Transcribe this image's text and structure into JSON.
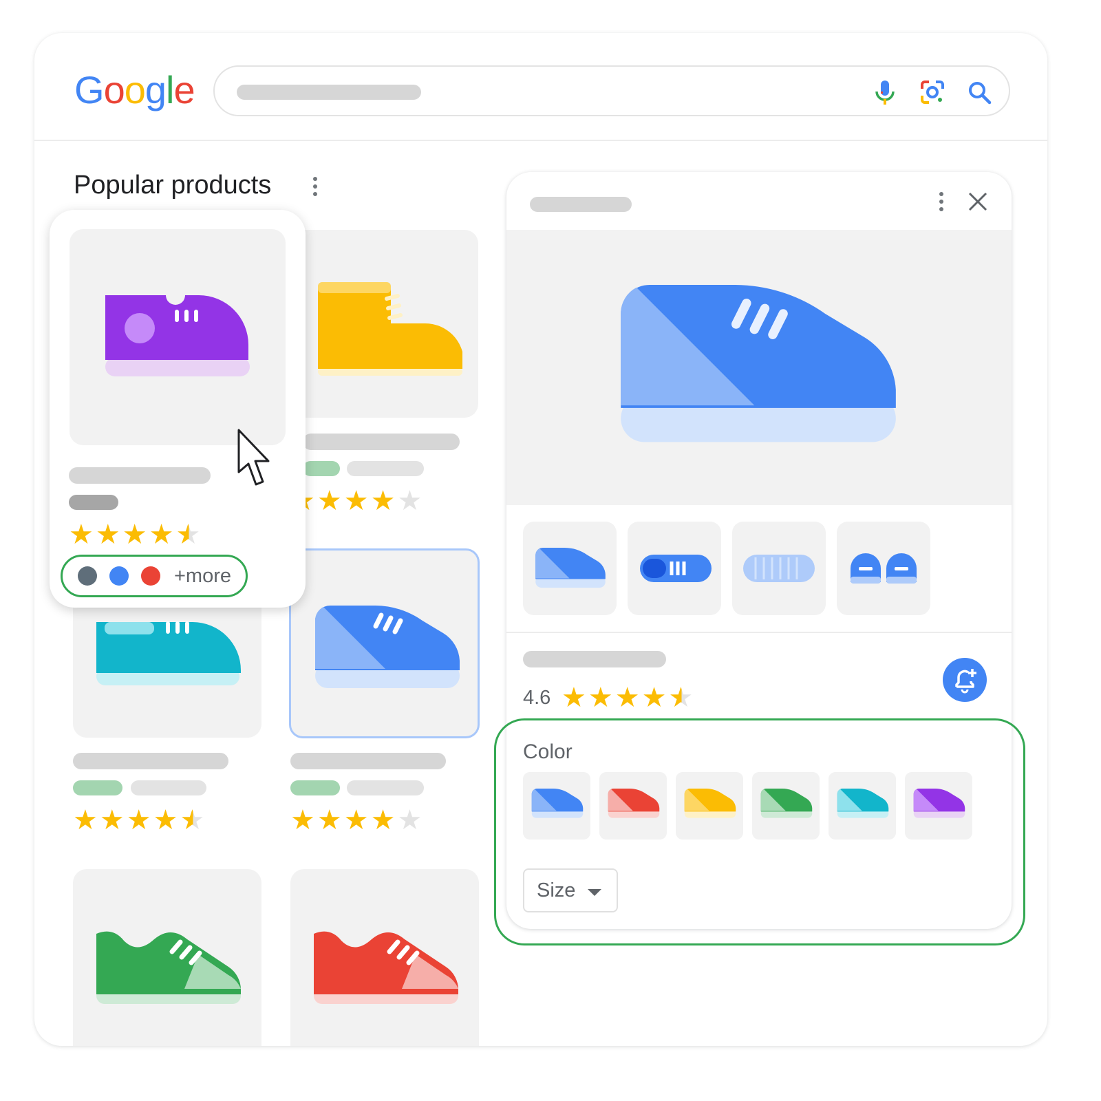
{
  "header": {
    "logo_letters": [
      "G",
      "o",
      "o",
      "g",
      "l",
      "e"
    ],
    "logo_colors": [
      "#4285f4",
      "#ea4335",
      "#fbbc04",
      "#4285f4",
      "#34a853",
      "#ea4335"
    ],
    "icons": [
      "microphone-icon",
      "lens-camera-icon",
      "search-icon"
    ]
  },
  "section": {
    "title": "Popular products",
    "more_icon": "more-vert-icon"
  },
  "products": [
    {
      "color": "purple",
      "rating_stars": "★★★★",
      "half": "★",
      "empty": "",
      "chip_colors": [
        "#5f6e7a",
        "#4285f4",
        "#ea4335"
      ],
      "chip_more": "+more"
    },
    {
      "color": "yellow",
      "rating_stars": "★★★★",
      "empty": "★"
    },
    {
      "color": "teal",
      "rating_stars": "★★★★",
      "half": "★",
      "empty": ""
    },
    {
      "color": "blue",
      "rating_stars": "★★★★",
      "empty": "★"
    },
    {
      "color": "green"
    },
    {
      "color": "red"
    }
  ],
  "detail": {
    "rating": "4.6",
    "rating_stars": "★★★★",
    "half": "★",
    "color_label": "Color",
    "size_label": "Size",
    "colors": [
      "#4285f4",
      "#ea4335",
      "#fbbc04",
      "#34a853",
      "#12b5cb",
      "#9334e6"
    ],
    "thumb_views": [
      "side",
      "top",
      "sole",
      "front"
    ],
    "icons": [
      "more-vert-icon",
      "close-icon",
      "price-alert-bell-icon",
      "dropdown-arrow-icon"
    ]
  }
}
